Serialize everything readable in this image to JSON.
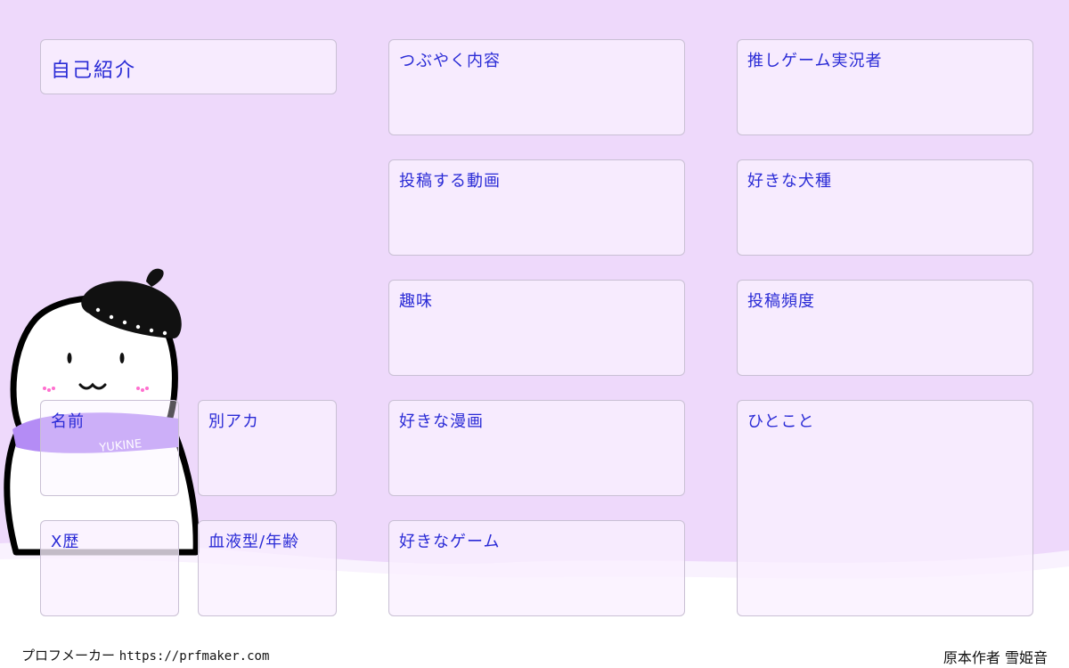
{
  "colors": {
    "background": "#eed9fb",
    "box_fill": "#faf0ff",
    "label": "#2a2bd6",
    "scarf": "#b48cf5"
  },
  "title": "自己紹介",
  "fields": {
    "tweet_content": "つぶやく内容",
    "favorite_streamer": "推しゲーム実況者",
    "posted_videos": "投稿する動画",
    "favorite_dog_breed": "好きな犬種",
    "hobby": "趣味",
    "post_frequency": "投稿頻度",
    "name": "名前",
    "alt_account": "別アカ",
    "favorite_manga": "好きな漫画",
    "comment": "ひとこと",
    "x_history": "X歴",
    "blood_type_age": "血液型/年齢",
    "favorite_game": "好きなゲーム"
  },
  "mascot": {
    "scarf_text": "YUKINE",
    "icon": "snowman-with-beret-icon"
  },
  "footer": {
    "maker_label": "プロフメーカー",
    "maker_url": "https://prfmaker.com",
    "credit": "原本作者 雪姫音"
  }
}
